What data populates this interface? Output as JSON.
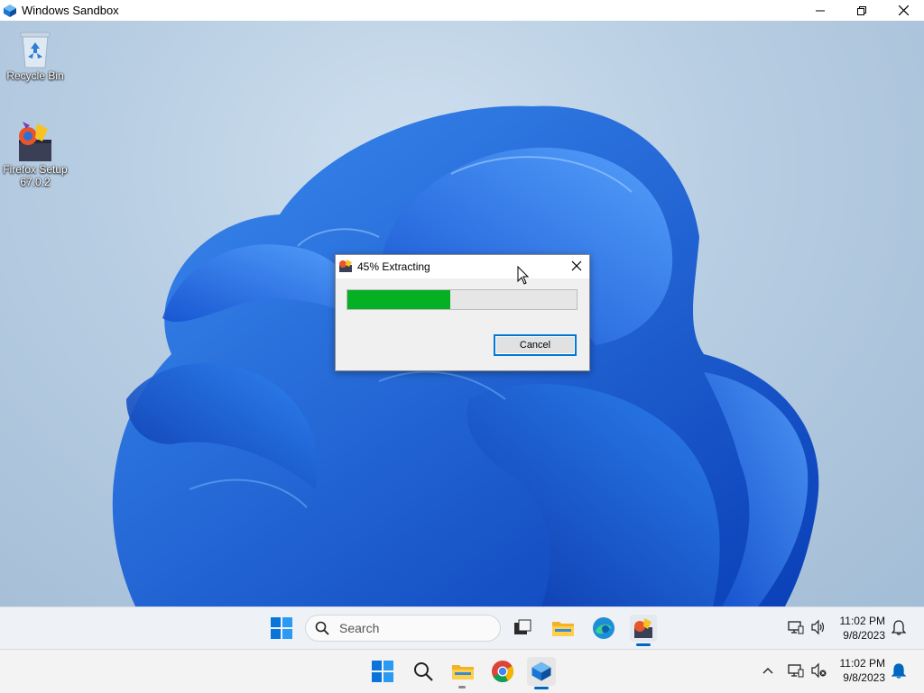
{
  "window": {
    "title": "Windows Sandbox",
    "controls": {
      "minimize": "minimize-icon",
      "maximize": "restore-icon",
      "close": "close-icon"
    }
  },
  "desktop": {
    "icons": [
      {
        "label": "Recycle Bin",
        "icon": "recycle-bin-icon"
      },
      {
        "label_line1": "Firefox Setup",
        "label_line2": "67.0.2",
        "icon": "installer-icon"
      }
    ]
  },
  "dialog": {
    "title": "45% Extracting",
    "progress": 0.45,
    "cancel_label": "Cancel",
    "colors": {
      "fill": "#06b025"
    }
  },
  "inner_taskbar": {
    "search_placeholder": "Search",
    "time": "11:02 PM",
    "date": "9/8/2023"
  },
  "host_taskbar": {
    "time": "11:02 PM",
    "date": "9/8/2023"
  },
  "colors": {
    "accent": "#0067c0",
    "bloom": "#1a5ce0"
  }
}
